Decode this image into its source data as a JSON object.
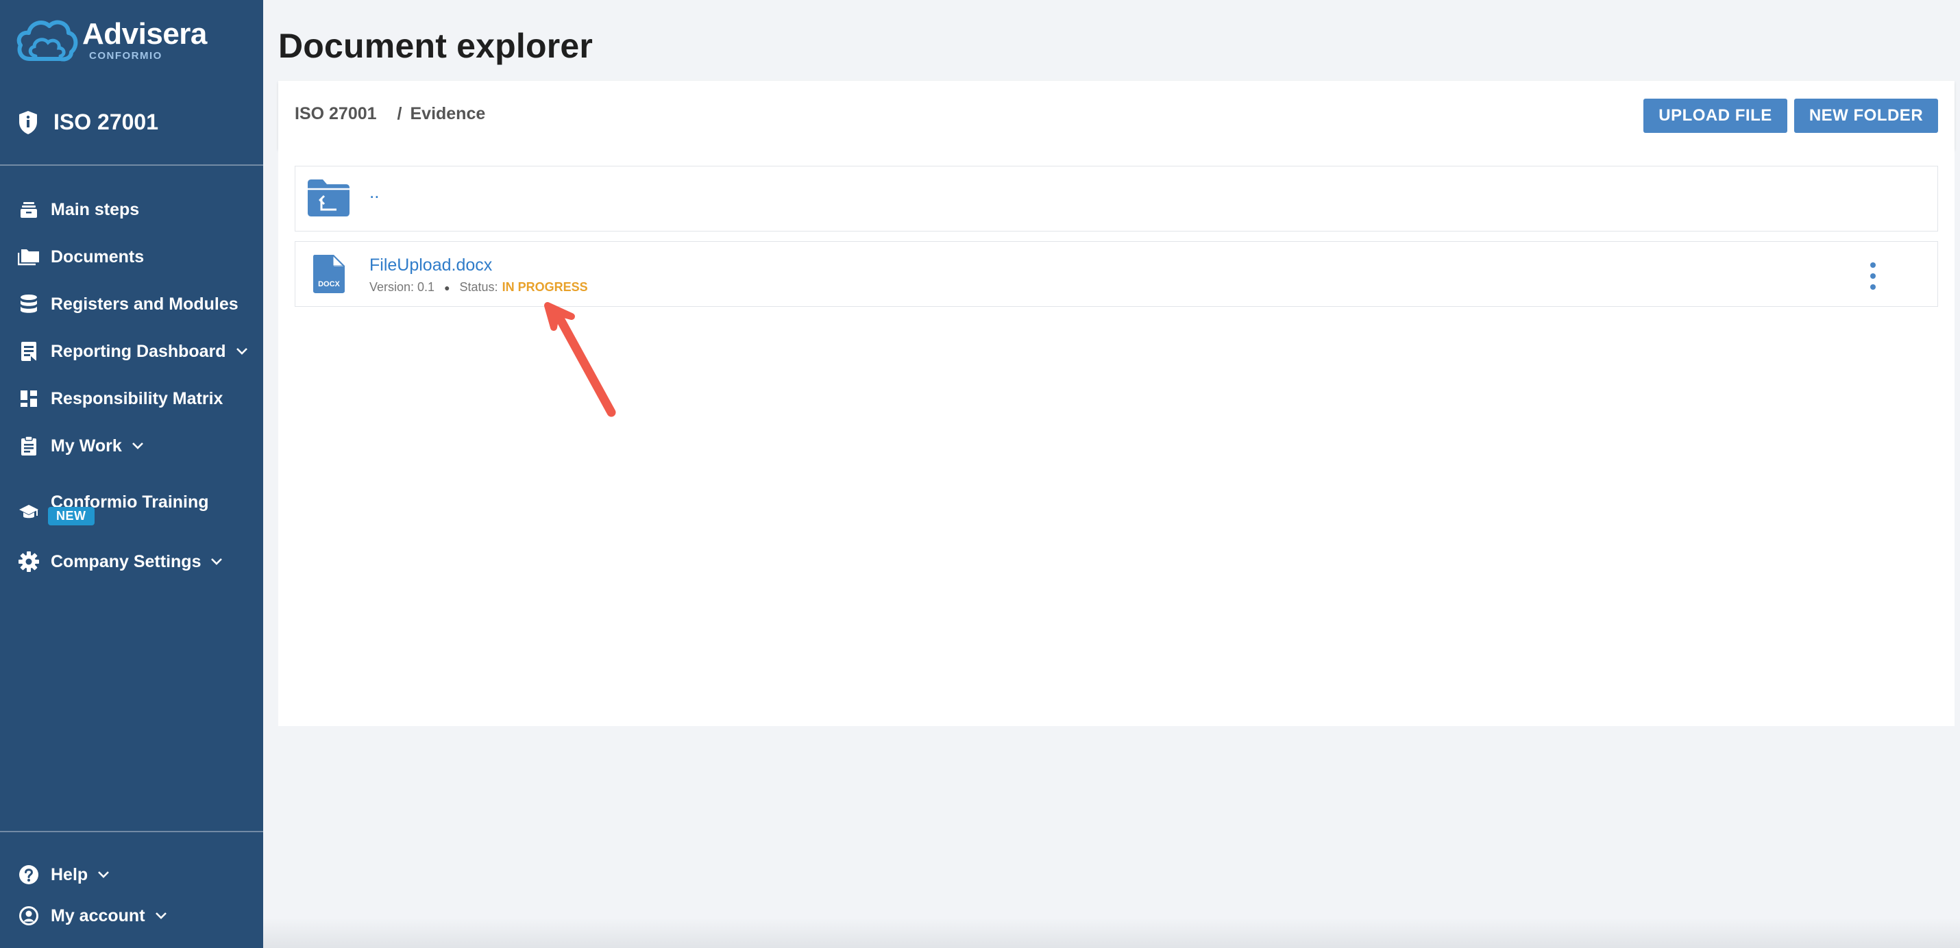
{
  "brand": {
    "name": "Advisera",
    "sub": "CONFORMIO"
  },
  "product": {
    "name": "ISO 27001",
    "icon": "shield-icon"
  },
  "sidebar": {
    "items": [
      {
        "label": "Main steps",
        "icon": "stack-icon"
      },
      {
        "label": "Documents",
        "icon": "folders-icon"
      },
      {
        "label": "Registers and Modules",
        "icon": "database-icon"
      },
      {
        "label": "Reporting Dashboard",
        "icon": "report-icon",
        "expandable": true
      },
      {
        "label": "Responsibility Matrix",
        "icon": "dashboard-grid-icon"
      },
      {
        "label": "My Work",
        "icon": "clipboard-icon",
        "expandable": true
      },
      {
        "label": "Conformio Training",
        "icon": "graduation-cap-icon",
        "badge": "NEW"
      },
      {
        "label": "Company Settings",
        "icon": "gear-icon",
        "expandable": true
      }
    ],
    "footer": [
      {
        "label": "Help",
        "icon": "help-circle-icon",
        "expandable": true
      },
      {
        "label": "My account",
        "icon": "account-circle-icon",
        "expandable": true
      }
    ]
  },
  "main": {
    "title": "Document explorer",
    "breadcrumb": {
      "root": "ISO 27001",
      "separator": "/",
      "current": "Evidence"
    },
    "buttons": {
      "upload": "UPLOAD FILE",
      "new_folder": "NEW FOLDER"
    },
    "parent_link": "..",
    "files": [
      {
        "name": "FileUpload.docx",
        "type_label": "DOCX",
        "version_label": "Version: 0.1",
        "status_label": "Status:",
        "status": "IN PROGRESS"
      }
    ]
  },
  "colors": {
    "sidebar": "#284e76",
    "accent": "#4a86c5",
    "link": "#2f7cc9",
    "status_in_progress": "#e8a12a",
    "badge": "#2196cf",
    "annotation": "#f05a4b"
  }
}
